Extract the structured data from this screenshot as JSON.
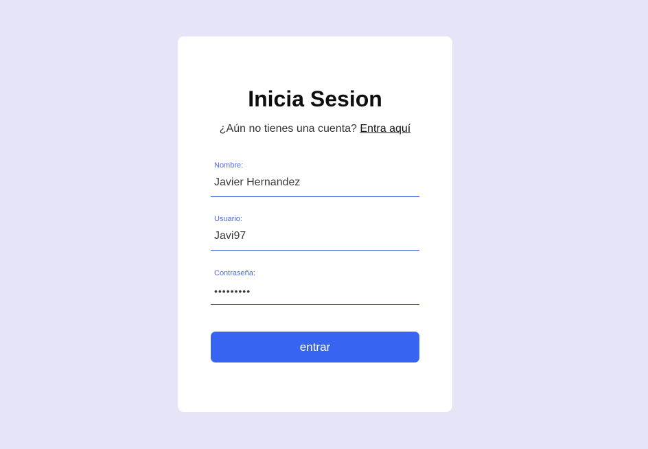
{
  "login": {
    "title": "Inicia Sesion",
    "subtitle_text": "¿Aún no tienes una cuenta? ",
    "subtitle_link": "Entra aquí",
    "fields": {
      "nombre": {
        "label": "Nombre:",
        "value": "Javier Hernandez"
      },
      "usuario": {
        "label": "Usuario:",
        "value": "Javi97"
      },
      "password": {
        "label": "Contraseña:",
        "value": "•••••••••"
      }
    },
    "submit_label": "entrar"
  },
  "colors": {
    "background": "#e6e4f7",
    "card": "#ffffff",
    "accent": "#3765f2",
    "label": "#4f6be0",
    "underline": "#3d5fd9"
  }
}
